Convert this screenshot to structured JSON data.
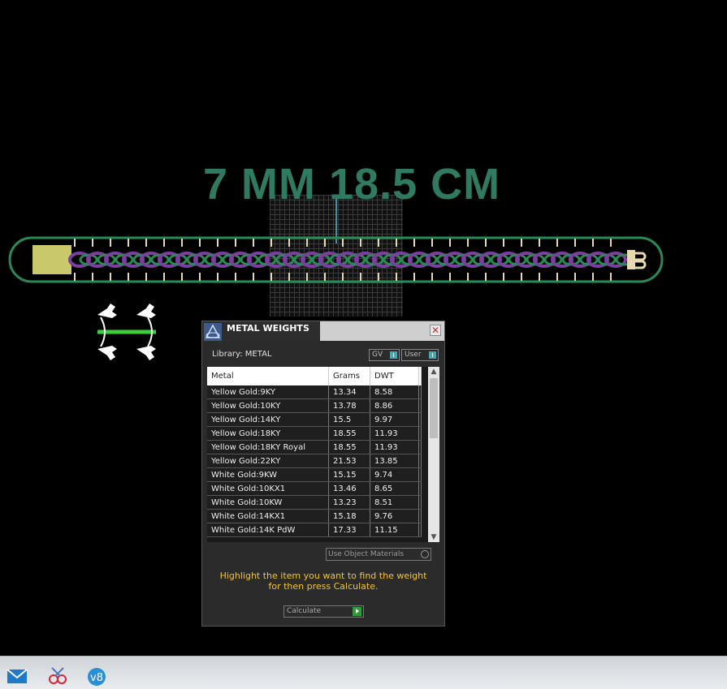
{
  "viewport": {
    "model_title": "7 MM 18.5 CM"
  },
  "dialog": {
    "title": "METAL WEIGHTS",
    "close_symbol": "✕",
    "library_label": "Library: METAL",
    "toggles": [
      {
        "label": "GV"
      },
      {
        "label": "User"
      }
    ],
    "columns": [
      "Metal",
      "Grams",
      "DWT"
    ],
    "rows": [
      {
        "metal": "Yellow Gold:9KY",
        "grams": "13.34",
        "dwt": "8.58"
      },
      {
        "metal": "Yellow Gold:10KY",
        "grams": "13.78",
        "dwt": "8.86"
      },
      {
        "metal": "Yellow Gold:14KY",
        "grams": "15.5",
        "dwt": "9.97"
      },
      {
        "metal": "Yellow Gold:18KY",
        "grams": "18.55",
        "dwt": "11.93"
      },
      {
        "metal": "Yellow Gold:18KY Royal",
        "grams": "18.55",
        "dwt": "11.93"
      },
      {
        "metal": "Yellow Gold:22KY",
        "grams": "21.53",
        "dwt": "13.85"
      },
      {
        "metal": "White Gold:9KW",
        "grams": "15.15",
        "dwt": "9.74"
      },
      {
        "metal": "White Gold:10KX1",
        "grams": "13.46",
        "dwt": "8.65"
      },
      {
        "metal": "White Gold:10KW",
        "grams": "13.23",
        "dwt": "8.51"
      },
      {
        "metal": "White Gold:14KX1",
        "grams": "15.18",
        "dwt": "9.76"
      },
      {
        "metal": "White Gold:14K PdW",
        "grams": "17.33",
        "dwt": "11.15"
      }
    ],
    "use_object_materials": "Use Object Materials",
    "hint_line1": "Highlight the item you want to find the weight",
    "hint_line2": "for then press Calculate.",
    "calculate_label": "Calculate"
  },
  "taskbar": {
    "icons": [
      "mail-icon",
      "snipping-tool-icon",
      "v8-app-icon"
    ]
  },
  "colors": {
    "title_green": "#2f7a60",
    "hint_yellow": "#f4c430",
    "chain_purple": "#7b3fa0",
    "chain_green": "#2a8a56"
  }
}
